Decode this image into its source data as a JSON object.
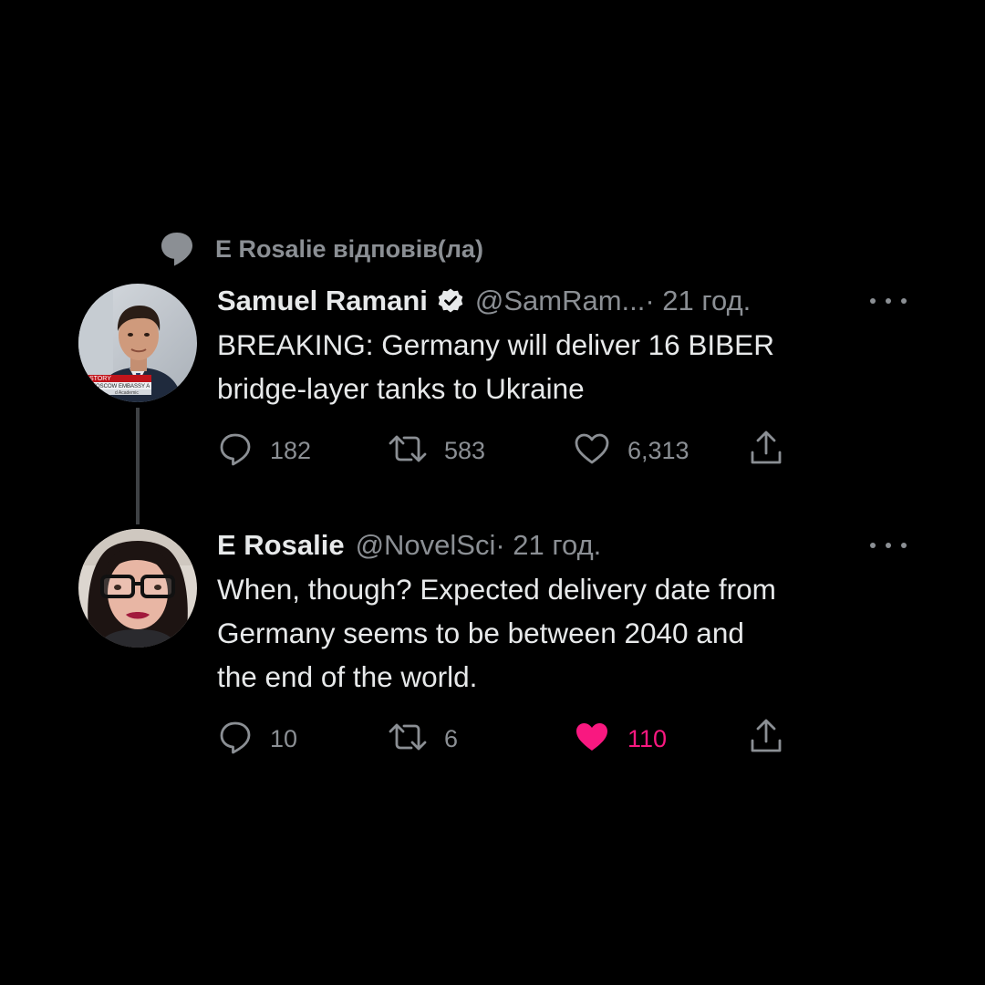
{
  "context": {
    "text": "E Rosalie відповів(ла)",
    "icon": "reply-bubble-icon"
  },
  "tweets": [
    {
      "name": "Samuel Ramani",
      "verified": true,
      "handle": "@SamRam...",
      "time": " · 21 год.",
      "body_lines": [
        "BREAKING: Germany will deliver 16 BIBER",
        "bridge-layer tanks to Ukraine"
      ],
      "avatar_caption_lines": [
        "STORY",
        "MOSCOW EMBASSY A",
        "d Academic"
      ],
      "replies": "182",
      "retweets": "583",
      "likes": "6,313",
      "liked": false
    },
    {
      "name": "E Rosalie",
      "verified": false,
      "handle": "@NovelSci",
      "time": " · 21 год.",
      "body_lines": [
        "When, though? Expected delivery date from",
        "Germany seems to be between 2040 and",
        "the end of the world."
      ],
      "replies": "10",
      "retweets": "6",
      "likes": "110",
      "liked": true
    }
  ],
  "colors": {
    "background": "#000000",
    "text": "#e7e9ea",
    "secondary": "#8b8f94",
    "like": "#f91880",
    "thread_line": "#3e4144"
  }
}
